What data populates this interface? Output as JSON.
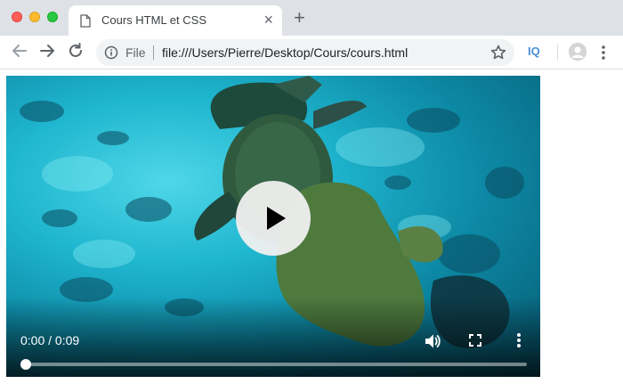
{
  "colors": {
    "tabbar_bg": "#dee1e6",
    "omnibox_bg": "#f1f3f4",
    "accent": "#4a90d9",
    "video_water": "#1fb6cf"
  },
  "window": {
    "controls": [
      "close",
      "minimize",
      "zoom"
    ]
  },
  "tab": {
    "title": "Cours HTML et CSS",
    "icon": "document-icon",
    "close": "×"
  },
  "newtab": {
    "label": "+"
  },
  "toolbar": {
    "back_icon": "arrow-left-icon",
    "forward_icon": "arrow-right-icon",
    "reload_icon": "reload-icon",
    "omnibox": {
      "scheme_label": "File",
      "url": "file:///Users/Pierre/Desktop/Cours/cours.html",
      "info_icon": "info-icon",
      "bookmark_icon": "star-icon"
    },
    "extension_label": "IQ",
    "avatar_icon": "avatar-icon",
    "menu_icon": "kebab-menu-icon"
  },
  "video": {
    "time": "0:00 / 0:09",
    "progress": 0.0,
    "controls": {
      "play_icon": "play-icon",
      "volume_icon": "volume-icon",
      "fullscreen_icon": "fullscreen-icon",
      "more_icon": "more-vert-icon"
    }
  }
}
